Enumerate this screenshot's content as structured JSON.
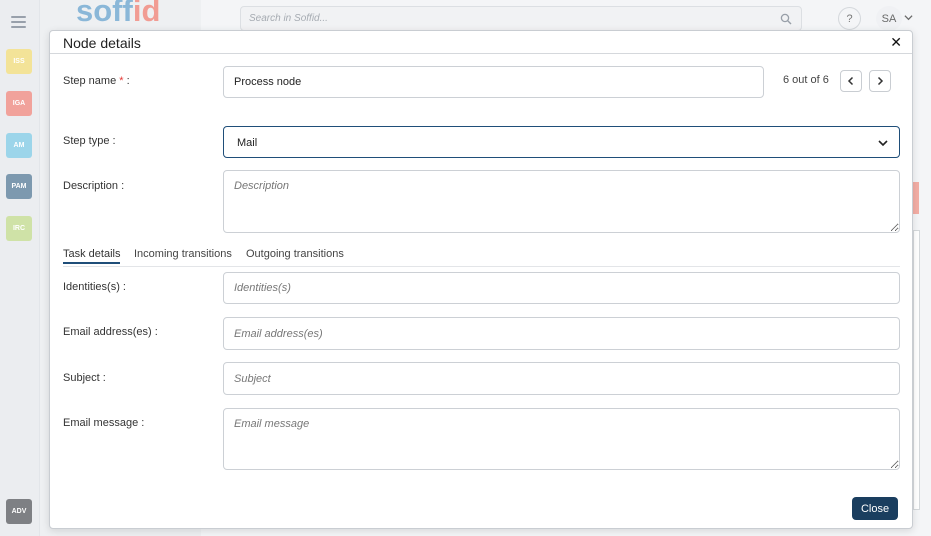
{
  "app": {
    "logo_part1": "soff",
    "logo_part2": "id",
    "search_placeholder": "Search in Soffid...",
    "help_label": "?",
    "user_initials": "SA",
    "modules": [
      {
        "label": "ISS",
        "color": "#f2e08a"
      },
      {
        "label": "IGA",
        "color": "#ef968e"
      },
      {
        "label": "AM",
        "color": "#8fd0e8"
      },
      {
        "label": "PAM",
        "color": "#6b8ba4"
      },
      {
        "label": "IRC",
        "color": "#c9df9b"
      },
      {
        "label": "ADV",
        "color": "#6d6f73"
      }
    ]
  },
  "modal": {
    "title": "Node details",
    "close_icon": "✕",
    "step_name_label": "Step name",
    "required_mark": "*",
    "label_suffix": " :",
    "step_name_value": "Process node",
    "pager_text": "6 out of 6",
    "step_type_label": "Step type :",
    "step_type_value": "Mail",
    "description_label": "Description :",
    "description_placeholder": "Description",
    "tabs": [
      "Task details",
      "Incoming transitions",
      "Outgoing transitions"
    ],
    "identities_label": "Identities(s) :",
    "identities_placeholder": "Identities(s)",
    "email_label": "Email address(es) :",
    "email_placeholder": "Email address(es)",
    "subject_label": "Subject :",
    "subject_placeholder": "Subject",
    "message_label": "Email message :",
    "message_placeholder": "Email message",
    "close_button": "Close"
  }
}
